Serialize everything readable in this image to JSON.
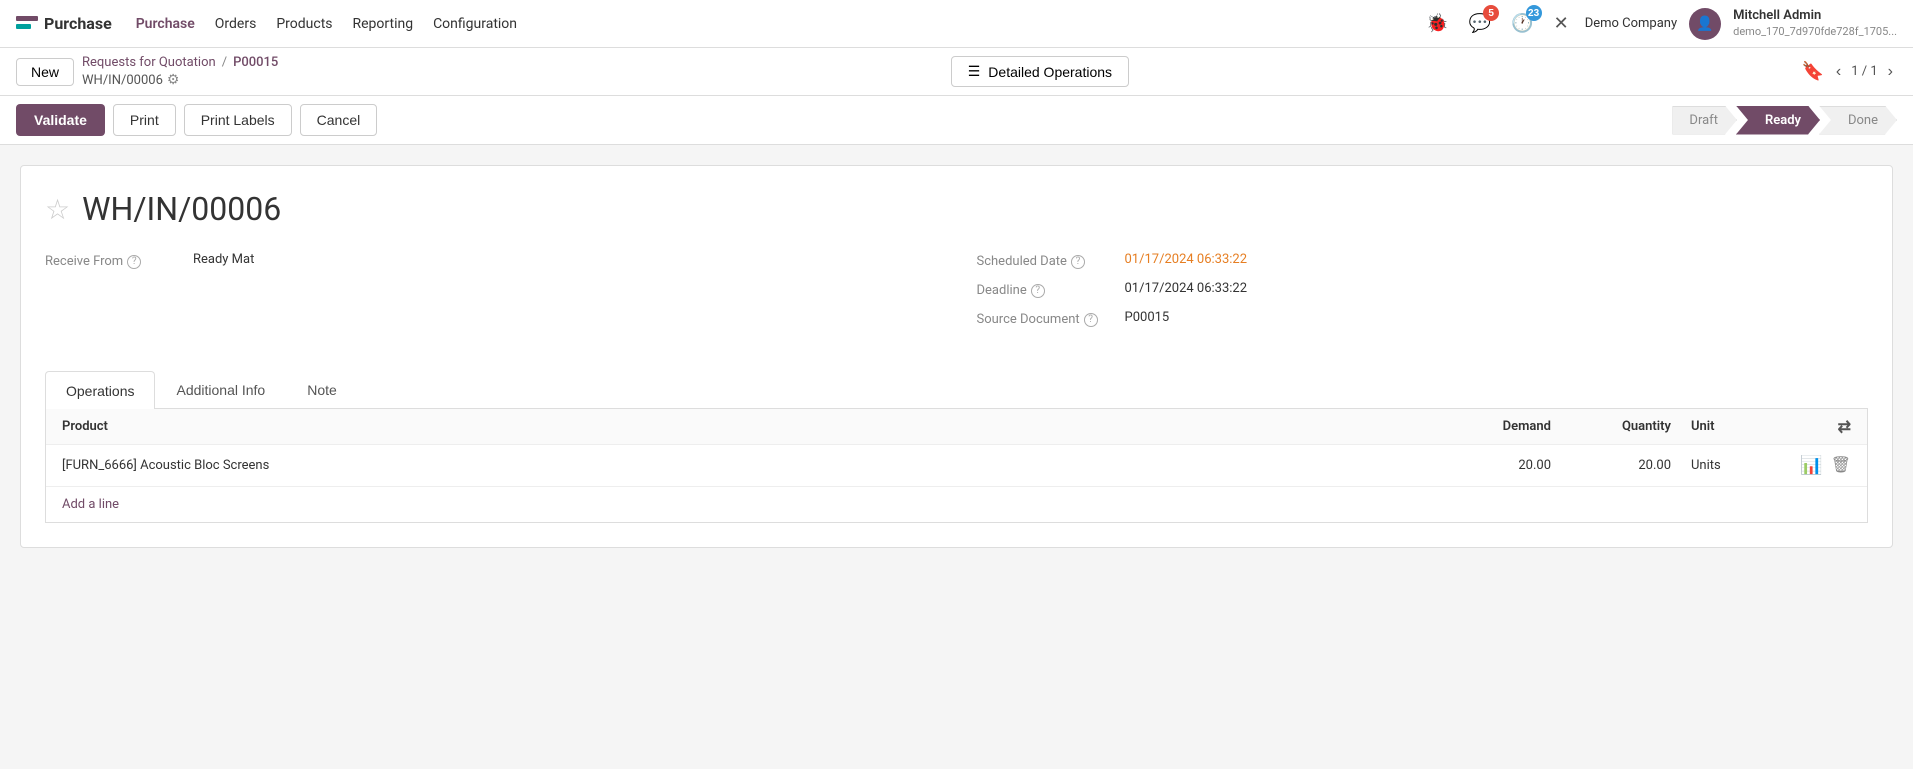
{
  "app": {
    "logo_text": "Purchase"
  },
  "topnav": {
    "menu_items": [
      {
        "label": "Purchase",
        "active": true
      },
      {
        "label": "Orders",
        "active": false
      },
      {
        "label": "Products",
        "active": false
      },
      {
        "label": "Reporting",
        "active": false
      },
      {
        "label": "Configuration",
        "active": false
      }
    ],
    "bug_icon": "🐞",
    "messages_badge": "5",
    "activity_badge": "23",
    "settings_icon": "✕",
    "company_name": "Demo Company",
    "user_name": "Mitchell Admin",
    "user_db": "demo_170_7d970fde728f_1705..."
  },
  "breadcrumb": {
    "new_label": "New",
    "rfq_label": "Requests for Quotation",
    "current_doc": "P00015",
    "wh_code": "WH/IN/00006",
    "detailed_ops_label": "Detailed Operations",
    "pager_text": "1 / 1"
  },
  "action_bar": {
    "validate_label": "Validate",
    "print_label": "Print",
    "print_labels_label": "Print Labels",
    "cancel_label": "Cancel"
  },
  "status_steps": [
    {
      "label": "Draft",
      "state": "inactive"
    },
    {
      "label": "Ready",
      "state": "active"
    },
    {
      "label": "Done",
      "state": "inactive"
    }
  ],
  "form": {
    "title": "WH/IN/00006",
    "receive_from_label": "Receive From",
    "receive_from_value": "Ready Mat",
    "scheduled_date_label": "Scheduled Date",
    "scheduled_date_value": "01/17/2024 06:33:22",
    "deadline_label": "Deadline",
    "deadline_value": "01/17/2024 06:33:22",
    "source_document_label": "Source Document",
    "source_document_value": "P00015"
  },
  "tabs": [
    {
      "label": "Operations",
      "active": true
    },
    {
      "label": "Additional Info",
      "active": false
    },
    {
      "label": "Note",
      "active": false
    }
  ],
  "table": {
    "col_product": "Product",
    "col_demand": "Demand",
    "col_quantity": "Quantity",
    "col_unit": "Unit",
    "rows": [
      {
        "product": "[FURN_6666] Acoustic Bloc Screens",
        "demand": "20.00",
        "quantity": "20.00",
        "unit": "Units"
      }
    ],
    "add_line_label": "Add a line"
  }
}
